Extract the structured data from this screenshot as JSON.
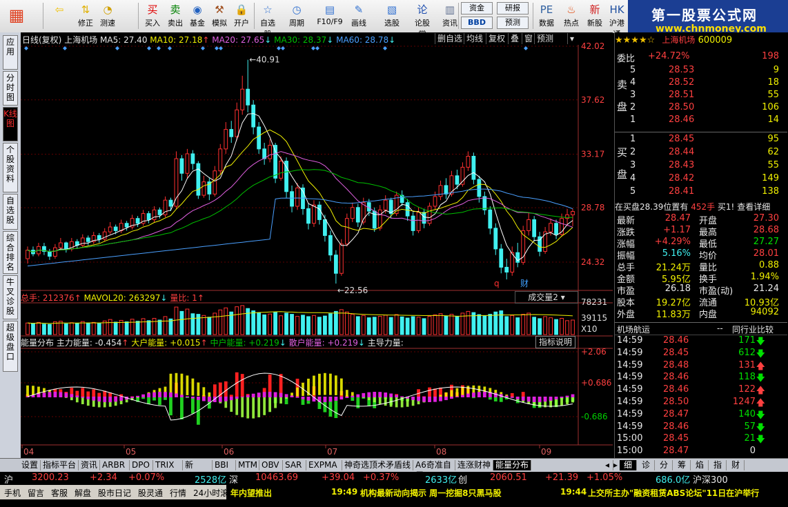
{
  "toolbar": {
    "buttons": [
      {
        "label": "",
        "icon": "grid-logo-icon",
        "color": "#e04020"
      },
      {
        "label": "",
        "icon": "back-arrow-icon",
        "color": "#f0c000"
      },
      {
        "label": "修正",
        "icon": "up-down-arrows-icon",
        "color": "#e0b000"
      },
      {
        "label": "测速",
        "icon": "speed-gauge-icon",
        "color": "#d0a000"
      },
      {
        "label": "买入",
        "icon": "buy-icon",
        "color": "#e00000"
      },
      {
        "label": "卖出",
        "icon": "sell-icon",
        "color": "#008000"
      },
      {
        "label": "基金",
        "icon": "fund-icon",
        "color": "#2060c0"
      },
      {
        "label": "模拟",
        "icon": "hammer-icon",
        "color": "#a05020"
      },
      {
        "label": "开户",
        "icon": "lock-icon",
        "color": "#806000"
      },
      {
        "label": "自选股",
        "icon": "star-icon",
        "color": "#3070d0"
      },
      {
        "label": "周期",
        "icon": "clock-icon",
        "color": "#3070d0"
      },
      {
        "label": "F10/F9",
        "icon": "doc-icon",
        "color": "#3070d0"
      },
      {
        "label": "画线",
        "icon": "pencil-icon",
        "color": "#3070d0"
      },
      {
        "label": "选股",
        "icon": "chart-icon",
        "color": "#3070d0"
      },
      {
        "label": "论股堂",
        "icon": "lun-icon",
        "color": "#2050b0"
      },
      {
        "label": "资讯",
        "icon": "news-icon",
        "color": "#607090"
      },
      {
        "label": "数据",
        "icon": "pe-icon",
        "color": "#3060a0"
      },
      {
        "label": "热点",
        "icon": "fire-icon",
        "color": "#e04000"
      },
      {
        "label": "新股",
        "icon": "ipo-icon",
        "color": "#d02020"
      },
      {
        "label": "沪港通",
        "icon": "hk-sse-icon",
        "color": "#2050a0"
      }
    ],
    "small_buttons": {
      "zijin": "资金",
      "bbd": "BBD",
      "yanbao": "研报",
      "yuce": "预测"
    }
  },
  "brand": {
    "title": "第一股票公式网",
    "url": "www.chnmoney.com"
  },
  "left_tabs": [
    "应用",
    "分时图",
    "K线图",
    "个股资料",
    "自选股",
    "综合排名",
    "牛叉诊股",
    "超级盘口"
  ],
  "chart_header": {
    "period": "日线(复权)",
    "stock": "上海机场",
    "ma5": "MA5: 27.40",
    "ma10": "MA10: 27.18",
    "ma20": "MA20: 27.65",
    "ma30": "MA30: 28.37",
    "ma60": "MA60: 28.78",
    "buttons": [
      "删自选",
      "均线",
      "复权",
      "叠",
      "窗",
      "预测"
    ]
  },
  "chart_labels": {
    "high": "40.91",
    "low": "22.56",
    "q": "q",
    "cai": "财"
  },
  "vol_header": {
    "total": "总手: 212376",
    "mavol": "MAVOL20: 263297",
    "liangbi": "量比: 1",
    "selector": "成交量2"
  },
  "energy_header": {
    "title": "能量分布",
    "zhuli": "主力能量: -0.454",
    "dahu": "大户能量: +0.015",
    "zhonghu": "中户能量: +0.219",
    "sanhu": "散户能量: +0.219",
    "zhudao": "主导力量:",
    "explain": "指标说明"
  },
  "colors": {
    "up": "#ff3030",
    "down": "#40f0f0",
    "ma5": "#ffffff",
    "ma10": "#f0f000",
    "ma20": "#e060e0",
    "ma30": "#00c000",
    "ma60": "#4aa0ff"
  },
  "chart_data": {
    "type": "candlestick",
    "price_axis": [
      "42.02",
      "37.62",
      "33.17",
      "28.78",
      "24.32"
    ],
    "price_ylim": [
      22,
      42.02
    ],
    "vol_axis": [
      "78231",
      "39115",
      "X10"
    ],
    "energy_axis": [
      "+2.06",
      "+0.686",
      "-0.686"
    ],
    "x_ticks": [
      "04",
      "05",
      "06",
      "07",
      "08",
      "09"
    ],
    "candles": [
      [
        24.6,
        25.3,
        25.6,
        24.2
      ],
      [
        25.3,
        25.0,
        25.6,
        24.8
      ],
      [
        25.0,
        25.6,
        25.9,
        24.8
      ],
      [
        25.6,
        25.2,
        25.9,
        24.9
      ],
      [
        25.2,
        24.8,
        25.4,
        24.5
      ],
      [
        24.8,
        25.5,
        25.8,
        24.6
      ],
      [
        25.5,
        25.9,
        26.3,
        25.3
      ],
      [
        25.9,
        25.4,
        26.0,
        25.1
      ],
      [
        25.4,
        26.0,
        26.3,
        25.2
      ],
      [
        26.0,
        25.7,
        26.2,
        25.4
      ],
      [
        25.7,
        26.3,
        26.6,
        25.5
      ],
      [
        26.3,
        26.0,
        26.5,
        25.7
      ],
      [
        26.0,
        26.5,
        26.8,
        25.8
      ],
      [
        26.5,
        26.2,
        26.7,
        25.9
      ],
      [
        26.2,
        26.8,
        27.1,
        26.0
      ],
      [
        26.8,
        27.2,
        27.6,
        26.6
      ],
      [
        27.2,
        26.9,
        27.4,
        26.6
      ],
      [
        26.9,
        27.5,
        27.8,
        26.7
      ],
      [
        27.5,
        27.2,
        27.7,
        26.9
      ],
      [
        27.2,
        27.9,
        28.2,
        27.0
      ],
      [
        27.9,
        27.5,
        28.1,
        27.2
      ],
      [
        27.5,
        28.3,
        28.6,
        27.3
      ],
      [
        28.3,
        27.8,
        28.5,
        27.5
      ],
      [
        27.8,
        28.6,
        28.9,
        27.6
      ],
      [
        28.6,
        28.2,
        28.8,
        27.9
      ],
      [
        28.2,
        29.4,
        29.7,
        28.0
      ],
      [
        29.4,
        28.9,
        29.6,
        28.5
      ],
      [
        28.9,
        32.8,
        33.4,
        28.7
      ],
      [
        32.8,
        31.6,
        33.1,
        31.0
      ],
      [
        31.6,
        33.2,
        33.6,
        31.2
      ],
      [
        33.2,
        32.4,
        33.5,
        31.9
      ],
      [
        32.4,
        29.8,
        32.6,
        29.5
      ],
      [
        29.8,
        30.9,
        31.4,
        29.6
      ],
      [
        30.9,
        29.9,
        31.2,
        29.4
      ],
      [
        29.9,
        31.8,
        32.2,
        29.7
      ],
      [
        31.8,
        33.6,
        34.0,
        31.5
      ],
      [
        33.6,
        35.2,
        35.8,
        33.2
      ],
      [
        35.2,
        34.6,
        35.9,
        34.1
      ],
      [
        34.6,
        36.8,
        37.4,
        34.3
      ],
      [
        36.8,
        38.5,
        39.6,
        36.4
      ],
      [
        38.5,
        37.2,
        40.91,
        36.6
      ],
      [
        37.2,
        35.4,
        37.6,
        34.8
      ],
      [
        35.4,
        33.6,
        35.8,
        33.2
      ],
      [
        33.6,
        32.8,
        34.1,
        32.3
      ],
      [
        32.8,
        33.9,
        34.4,
        32.5
      ],
      [
        33.9,
        31.2,
        34.1,
        30.8
      ],
      [
        31.2,
        32.6,
        33.0,
        31.0
      ],
      [
        32.6,
        30.1,
        32.9,
        29.6
      ],
      [
        30.1,
        28.9,
        30.6,
        28.4
      ],
      [
        28.9,
        30.4,
        30.8,
        28.6
      ],
      [
        30.4,
        28.7,
        30.7,
        28.2
      ],
      [
        28.7,
        27.5,
        29.1,
        27.0
      ],
      [
        27.5,
        29.0,
        29.4,
        27.2
      ],
      [
        29.0,
        27.8,
        29.3,
        27.4
      ],
      [
        27.8,
        26.5,
        28.2,
        26.0
      ],
      [
        26.5,
        24.9,
        26.9,
        24.4
      ],
      [
        24.9,
        23.4,
        25.3,
        22.56
      ],
      [
        23.4,
        25.8,
        26.2,
        23.2
      ],
      [
        25.8,
        27.9,
        28.3,
        25.6
      ],
      [
        27.9,
        28.8,
        29.2,
        27.6
      ],
      [
        28.8,
        27.6,
        29.1,
        27.2
      ],
      [
        27.6,
        29.2,
        29.6,
        27.4
      ],
      [
        29.2,
        28.5,
        29.5,
        28.1
      ],
      [
        28.5,
        27.1,
        28.8,
        26.8
      ],
      [
        27.1,
        28.6,
        29.0,
        26.9
      ],
      [
        28.6,
        29.4,
        29.8,
        28.3
      ],
      [
        29.4,
        28.3,
        29.6,
        27.9
      ],
      [
        28.3,
        29.8,
        30.1,
        28.1
      ],
      [
        29.8,
        29.2,
        30.2,
        28.9
      ],
      [
        29.2,
        28.1,
        29.5,
        27.7
      ],
      [
        28.1,
        26.9,
        28.4,
        26.5
      ],
      [
        26.9,
        28.4,
        28.8,
        26.7
      ],
      [
        28.4,
        27.5,
        28.7,
        27.1
      ],
      [
        27.5,
        28.9,
        29.2,
        27.3
      ],
      [
        28.9,
        29.7,
        30.1,
        28.6
      ],
      [
        29.7,
        30.6,
        31.0,
        29.4
      ],
      [
        30.6,
        29.9,
        31.2,
        29.5
      ],
      [
        29.9,
        31.4,
        31.8,
        29.7
      ],
      [
        31.4,
        30.7,
        31.9,
        30.3
      ],
      [
        30.7,
        32.1,
        32.5,
        30.5
      ],
      [
        32.1,
        33.0,
        33.4,
        31.8
      ],
      [
        33.0,
        31.1,
        33.3,
        30.7
      ],
      [
        31.1,
        29.7,
        31.4,
        29.2
      ],
      [
        29.7,
        28.6,
        30.1,
        28.2
      ],
      [
        28.6,
        27.1,
        28.9,
        26.6
      ],
      [
        27.1,
        25.4,
        27.5,
        24.9
      ],
      [
        25.4,
        23.9,
        25.8,
        23.4
      ],
      [
        23.9,
        23.5,
        24.6,
        22.9
      ],
      [
        23.5,
        25.1,
        25.6,
        23.2
      ],
      [
        25.1,
        24.3,
        25.9,
        23.9
      ],
      [
        24.3,
        26.9,
        27.3,
        24.1
      ],
      [
        26.9,
        27.8,
        28.4,
        26.5
      ],
      [
        27.8,
        26.4,
        28.1,
        26.0
      ],
      [
        26.4,
        25.2,
        26.8,
        24.8
      ],
      [
        25.2,
        26.8,
        27.2,
        25.0
      ],
      [
        26.8,
        27.5,
        27.9,
        26.5
      ],
      [
        27.5,
        26.6,
        27.8,
        26.2
      ],
      [
        26.6,
        27.9,
        28.3,
        26.4
      ],
      [
        27.9,
        28.2,
        28.68,
        27.27
      ],
      [
        28.2,
        28.47,
        28.68,
        27.27
      ]
    ],
    "volumes": [
      0.4,
      0.38,
      0.42,
      0.36,
      0.35,
      0.44,
      0.46,
      0.37,
      0.41,
      0.39,
      0.45,
      0.4,
      0.42,
      0.38,
      0.47,
      0.52,
      0.43,
      0.49,
      0.44,
      0.53,
      0.46,
      0.55,
      0.48,
      0.56,
      0.5,
      0.62,
      0.54,
      0.95,
      0.8,
      0.88,
      0.72,
      0.7,
      0.66,
      0.6,
      0.74,
      0.85,
      0.92,
      0.78,
      0.96,
      1.0,
      0.9,
      0.82,
      0.75,
      0.68,
      0.71,
      0.77,
      0.65,
      0.74,
      0.7,
      0.63,
      0.67,
      0.62,
      0.66,
      0.6,
      0.64,
      0.72,
      0.8,
      0.86,
      0.78,
      0.7,
      0.62,
      0.66,
      0.58,
      0.6,
      0.63,
      0.67,
      0.59,
      0.69,
      0.61,
      0.57,
      0.62,
      0.6,
      0.55,
      0.63,
      0.68,
      0.72,
      0.64,
      0.7,
      0.63,
      0.74,
      0.8,
      0.76,
      0.69,
      0.64,
      0.7,
      0.78,
      0.82,
      0.62,
      0.66,
      0.58,
      0.7,
      0.74,
      0.6,
      0.55,
      0.62,
      0.58,
      0.52,
      0.56,
      0.48,
      0.5
    ]
  },
  "quote": {
    "name": "上海机场",
    "code": "600009",
    "weibi_label": "委比",
    "weibi_pct": "+24.72%",
    "weibi_val": "198",
    "sell_label": "卖盘",
    "buy_label": "买盘",
    "sell": [
      [
        "5",
        "28.53",
        "9"
      ],
      [
        "4",
        "28.52",
        "18"
      ],
      [
        "3",
        "28.51",
        "55"
      ],
      [
        "2",
        "28.50",
        "106"
      ],
      [
        "1",
        "28.46",
        "14"
      ]
    ],
    "buy": [
      [
        "1",
        "28.45",
        "95"
      ],
      [
        "2",
        "28.44",
        "62"
      ],
      [
        "3",
        "28.43",
        "55"
      ],
      [
        "4",
        "28.42",
        "149"
      ],
      [
        "5",
        "28.41",
        "138"
      ]
    ],
    "zaimai": "在买盘28.39位置有",
    "zaimai_qty": "452手",
    "buy_one": "买1!",
    "detail": "查看详细",
    "stats": [
      [
        "最新",
        "28.47",
        "开盘",
        "27.30"
      ],
      [
        "涨跌",
        "+1.17",
        "最高",
        "28.68"
      ],
      [
        "涨幅",
        "+4.29%",
        "最低",
        "27.27"
      ],
      [
        "振幅",
        "5.16%",
        "均价",
        "28.01"
      ],
      [
        "总手",
        "21.24万",
        "量比",
        "0.88"
      ],
      [
        "金额",
        "5.95亿",
        "换手",
        "1.94%"
      ],
      [
        "市盈",
        "26.18",
        "市盈(动)",
        "21.24"
      ],
      [
        "股本",
        "19.27亿",
        "流通",
        "10.93亿"
      ],
      [
        "外盘",
        "11.83万",
        "内盘",
        "94092"
      ]
    ],
    "tabs": {
      "hangyun": "机场航运",
      "compare": "同行业比较"
    },
    "ticks": [
      [
        "14:59",
        "28.46",
        "171",
        "down"
      ],
      [
        "14:59",
        "28.45",
        "612",
        "down"
      ],
      [
        "14:59",
        "28.48",
        "131",
        "up"
      ],
      [
        "14:59",
        "28.46",
        "118",
        "down"
      ],
      [
        "14:59",
        "28.46",
        "122",
        "up"
      ],
      [
        "14:59",
        "28.50",
        "1247",
        "up"
      ],
      [
        "14:59",
        "28.47",
        "140",
        "down"
      ],
      [
        "14:59",
        "28.46",
        "57",
        "down"
      ],
      [
        "15:00",
        "28.45",
        "21",
        "down"
      ],
      [
        "15:00",
        "28.47",
        "0",
        ""
      ]
    ]
  },
  "bottom_tabs": [
    "设置",
    "指标平台",
    "资讯",
    "ARBR",
    "DPO",
    "TRIX",
    "新DMA",
    "BBI",
    "MTM",
    "OBV",
    "SAR",
    "EXPMA",
    "神奇选顶术矛盾线",
    "A6奇准自用",
    "连涨财神",
    "能量分布"
  ],
  "right_tabs": [
    "细",
    "诊",
    "分",
    "筹",
    "焰",
    "指",
    "财"
  ],
  "index_bar": {
    "hu": "沪",
    "hu_val": "3200.23",
    "hu_chg": "+2.34",
    "hu_pct": "+0.07%",
    "hu_amt": "2528亿",
    "shen": "深",
    "shen_val": "10463.69",
    "shen_chg": "+39.04",
    "shen_pct": "+0.37%",
    "shen_amt": "2633亿",
    "chuang": "创",
    "chuang_val": "2060.51",
    "chuang_chg": "+21.39",
    "chuang_pct": "+1.05%",
    "chuang_amt": "686.0亿",
    "hs300": "沪深300"
  },
  "status_bar": {
    "items": [
      "手机",
      "留言",
      "客服",
      "解盘",
      "股市日记",
      "股灵通",
      "行情",
      "24小时滚动"
    ],
    "news1": "年内望推出",
    "news2_time": "19:49",
    "news2": "机构最新动向揭示 周一挖掘8只黑马股",
    "news3_time": "19:44",
    "news3": "上交所主办\"融资租赁ABS论坛\"11日在沪举行"
  }
}
